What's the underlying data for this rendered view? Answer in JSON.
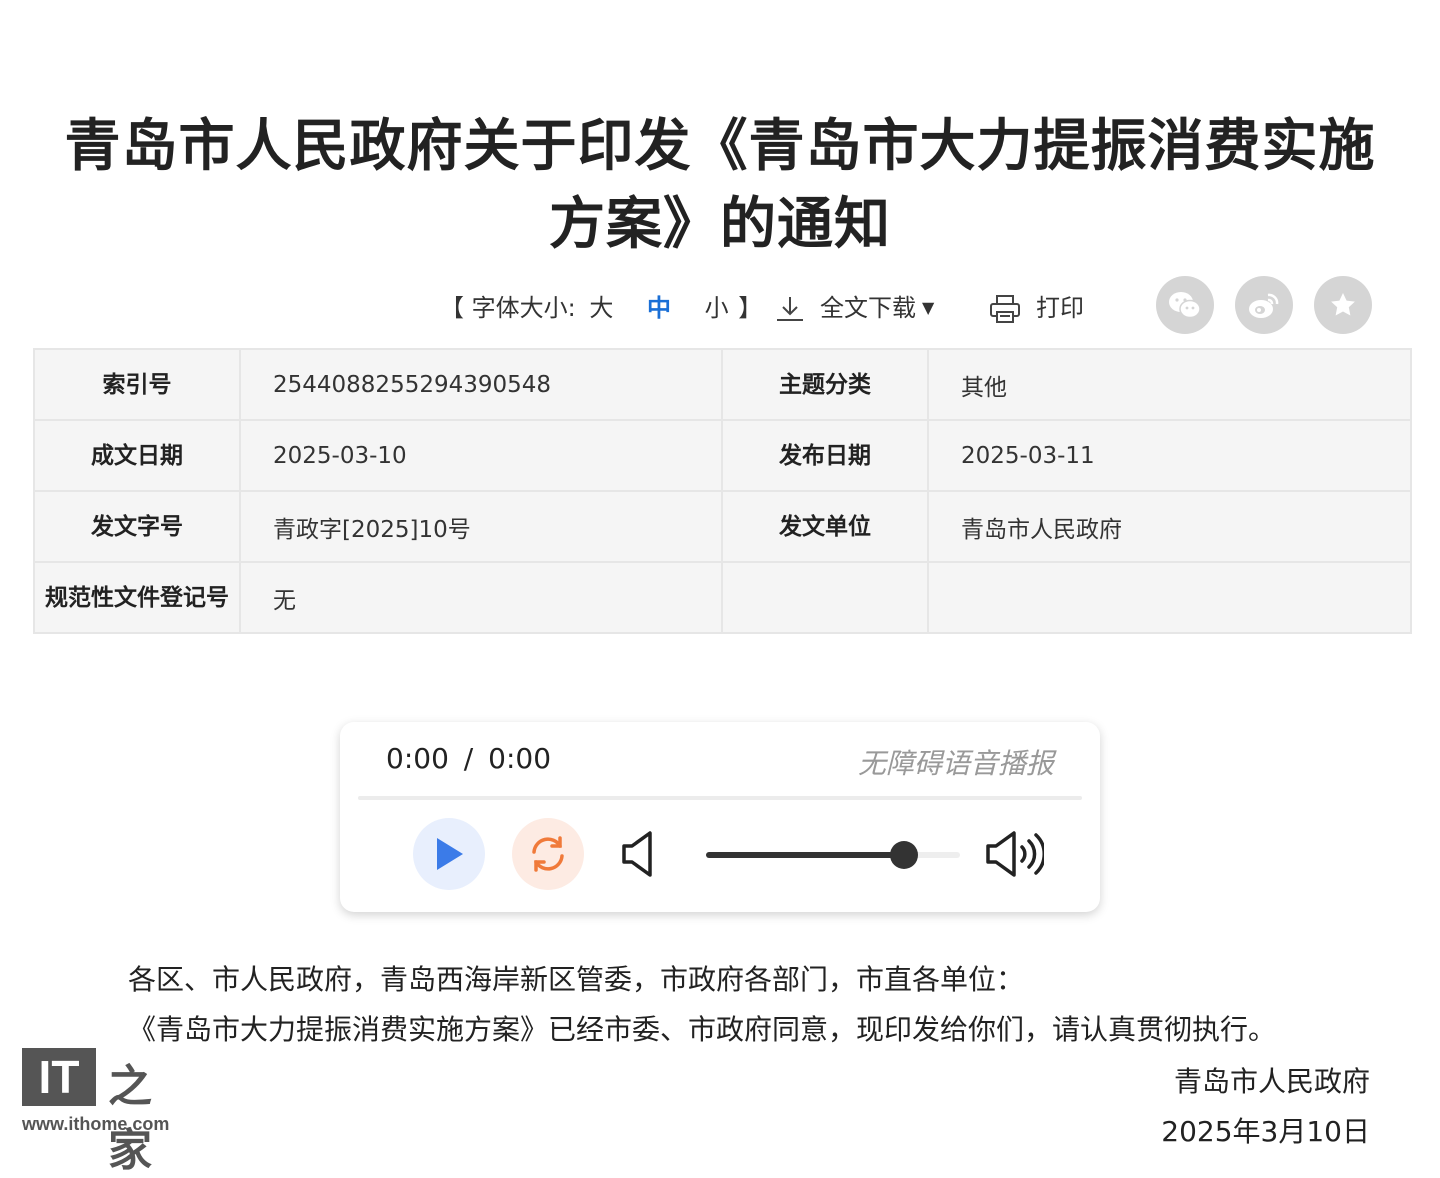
{
  "title": "青岛市人民政府关于印发《青岛市大力提振消费实施方案》的通知",
  "toolbar": {
    "font_size_prefix": "【 字体大小:",
    "font_large": "大",
    "font_medium": "中",
    "font_small": "小",
    "font_size_suffix": "】",
    "download_label": "全文下载",
    "print_label": "打印",
    "active_font_size": "中"
  },
  "share_icons": [
    "wechat-icon",
    "weibo-icon",
    "favorite-star-icon"
  ],
  "meta": {
    "index_label": "索引号",
    "index_value": "2544088255294390548",
    "topic_label": "主题分类",
    "topic_value": "其他",
    "written_date_label": "成文日期",
    "written_date_value": "2025-03-10",
    "publish_date_label": "发布日期",
    "publish_date_value": "2025-03-11",
    "doc_number_label": "发文字号",
    "doc_number_value": "青政字[2025]10号",
    "issuer_label": "发文单位",
    "issuer_value": "青岛市人民政府",
    "registration_label": "规范性文件登记号",
    "registration_value": "无"
  },
  "player": {
    "current_time": "0:00",
    "time_separator": "/",
    "duration": "0:00",
    "accessible_label": "无障碍语音播报",
    "volume": 0.78
  },
  "body": {
    "salutation": "各区、市人民政府，青岛西海岸新区管委，市政府各部门，市直各单位：",
    "paragraph": "《青岛市大力提振消费实施方案》已经市委、市政府同意，现印发给你们，请认真贯彻执行。",
    "signature_org": "青岛市人民政府",
    "signature_date": "2025年3月10日"
  },
  "watermark": {
    "logo_text": "IT",
    "logo_cn": "之家",
    "url": "www.ithome.com"
  },
  "colors": {
    "active_link": "#1a6fd6",
    "play_icon": "#3b7be8",
    "loop_icon": "#f07a3a",
    "table_bg": "#f5f5f5"
  }
}
